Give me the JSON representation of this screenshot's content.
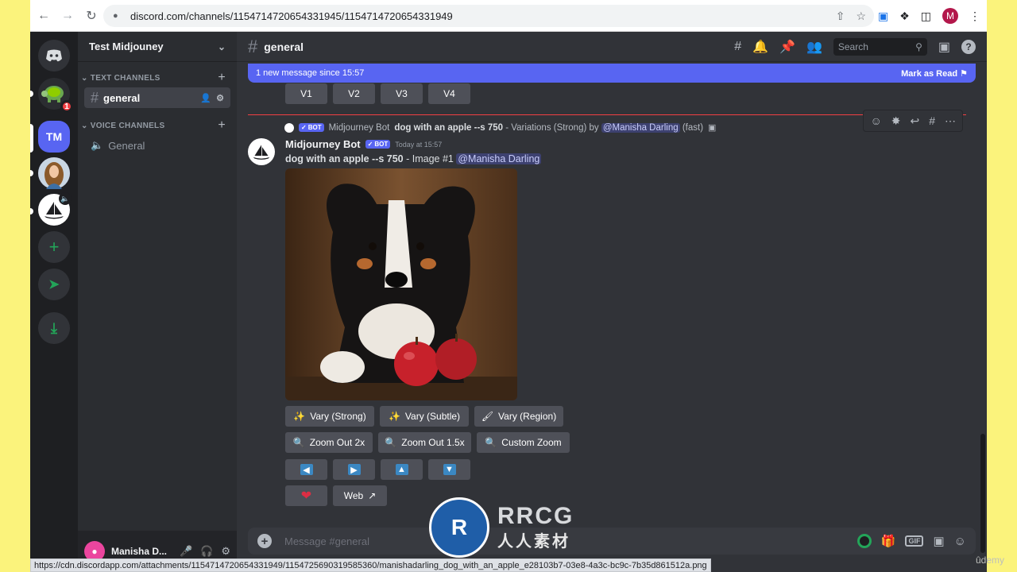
{
  "browser": {
    "url": "discord.com/channels/1154714720654331945/1154714720654331949",
    "profile_initial": "M",
    "status_url": "https://cdn.discordapp.com/attachments/1154714720654331949/1154725690319585360/manishadarling_dog_with_an_apple_e28103b7-03e8-4a3c-bc9c-7b35d861512a.png"
  },
  "rail": {
    "server_tm": "TM",
    "badge_count": "1"
  },
  "sidebar": {
    "guild_name": "Test Midjouney",
    "text_category": "TEXT CHANNELS",
    "voice_category": "VOICE CHANNELS",
    "text_channel": "general",
    "voice_channel": "General",
    "user_name": "Manisha D..."
  },
  "main": {
    "channel_title": "general",
    "search_placeholder": "Search",
    "new_messages": "1 new message since 15:57",
    "mark_read": "Mark as Read",
    "prev_buttons": [
      "V1",
      "V2",
      "V3",
      "V4"
    ],
    "reply": {
      "bot_badge": "BOT",
      "author": "Midjourney Bot",
      "prompt": "dog with an apple --s 750",
      "suffix": " - Variations (Strong) by ",
      "mention": "@Manisha Darling",
      "speed": "(fast)"
    },
    "message": {
      "author": "Midjourney Bot",
      "bot_badge": "BOT",
      "timestamp": "Today at 15:57",
      "prompt": "dog with an apple --s 750",
      "suffix": " - Image #1 ",
      "mention": "@Manisha Darling"
    },
    "buttons": {
      "vary_strong": "Vary (Strong)",
      "vary_subtle": "Vary (Subtle)",
      "vary_region": "Vary (Region)",
      "zoom_2x": "Zoom Out 2x",
      "zoom_15x": "Zoom Out 1.5x",
      "custom_zoom": "Custom Zoom",
      "web": "Web"
    },
    "composer_placeholder": "Message #general",
    "gif_label": "GIF"
  },
  "watermark": {
    "brand": "RRCG",
    "cn": "人人素材",
    "udemy": "ûdemy"
  }
}
